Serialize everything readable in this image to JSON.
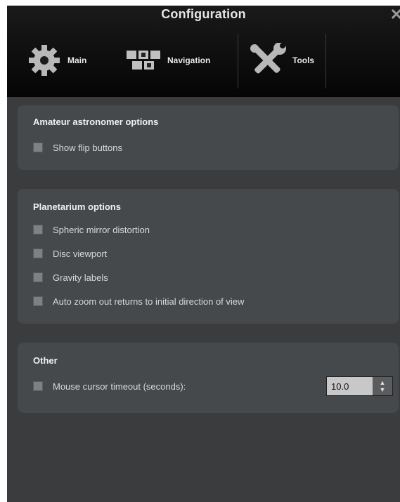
{
  "window": {
    "title": "Configuration"
  },
  "tabs": [
    {
      "label": "Main",
      "icon": "gear-icon"
    },
    {
      "label": "Navigation",
      "icon": "navigation-icon"
    },
    {
      "label": "Tools",
      "icon": "tools-icon"
    }
  ],
  "groups": {
    "amateur": {
      "title": "Amateur astronomer options",
      "options": [
        {
          "label": "Show flip buttons",
          "checked": false
        }
      ]
    },
    "planetarium": {
      "title": "Planetarium options",
      "options": [
        {
          "label": "Spheric mirror distortion",
          "checked": false
        },
        {
          "label": "Disc viewport",
          "checked": false
        },
        {
          "label": "Gravity labels",
          "checked": false
        },
        {
          "label": "Auto zoom out returns to initial direction of view",
          "checked": false
        }
      ]
    },
    "other": {
      "title": "Other",
      "options": [
        {
          "label": "Mouse cursor timeout (seconds):",
          "checked": false
        }
      ],
      "timeout_value": "10.0"
    }
  },
  "colors": {
    "header": "#0a0a0a",
    "panel": "#3a3c3e",
    "group": "#46494b"
  }
}
